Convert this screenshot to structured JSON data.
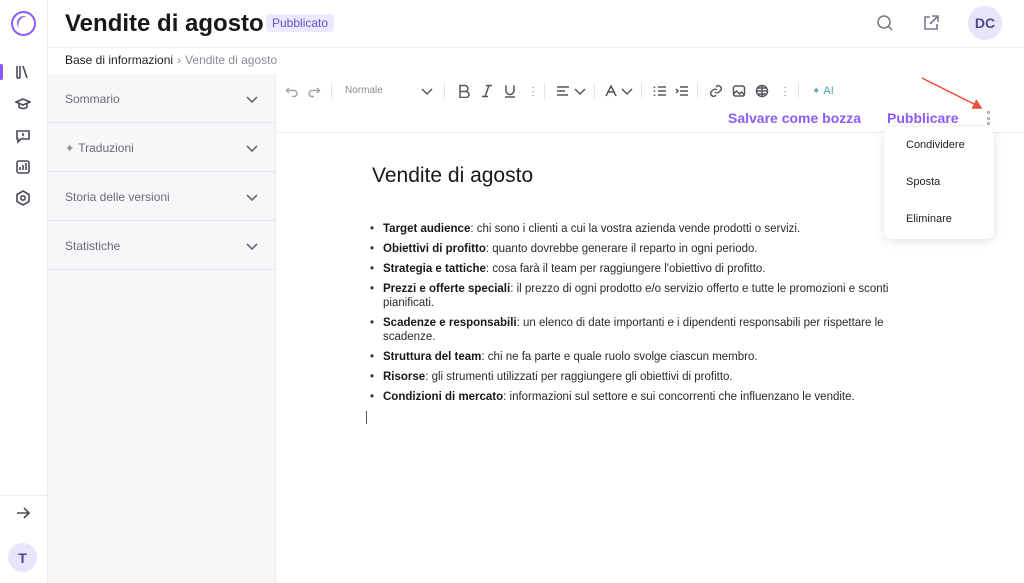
{
  "header": {
    "title": "Vendite di agosto",
    "status_badge": "Pubblicato",
    "avatar_initials": "DC"
  },
  "rail": {
    "icons": [
      "book-icon",
      "graduation-cap-icon",
      "feedback-icon",
      "analytics-icon",
      "settings-icon"
    ],
    "expand_icon": "arrow-right-icon",
    "user_initial": "T"
  },
  "breadcrumb": {
    "root": "Base di informazioni",
    "current": "Vendite di agosto"
  },
  "panel": {
    "sections": [
      {
        "label": "Sommario"
      },
      {
        "label": "Traduzioni"
      },
      {
        "label": "Storia delle versioni"
      },
      {
        "label": "Statistiche"
      }
    ]
  },
  "toolbar": {
    "style": "Normale",
    "ai_label": "AI"
  },
  "actions": {
    "save_draft": "Salvare come bozza",
    "publish": "Pubblicare"
  },
  "menu": {
    "items": [
      "Condividere",
      "Sposta",
      "Eliminare"
    ]
  },
  "document": {
    "title": "Vendite di agosto",
    "items": [
      {
        "term": "Target audience",
        "text": ": chi sono i clienti a cui la vostra azienda vende prodotti o servizi."
      },
      {
        "term": "Obiettivi di profitto",
        "text": ": quanto dovrebbe generare il reparto in ogni periodo."
      },
      {
        "term": "Strategia e tattiche",
        "text": ": cosa farà il team per raggiungere l'obiettivo di profitto."
      },
      {
        "term": "Prezzi e offerte speciali",
        "text": ": il prezzo di ogni prodotto e/o servizio offerto e tutte le promozioni e sconti pianificati."
      },
      {
        "term": "Scadenze e responsabili",
        "text": ": un elenco di date importanti e i dipendenti responsabili per rispettare le scadenze."
      },
      {
        "term": "Struttura del team",
        "text": ": chi ne fa parte e quale ruolo svolge ciascun membro."
      },
      {
        "term": "Risorse",
        "text": ": gli strumenti utilizzati per raggiungere gli obiettivi di profitto."
      },
      {
        "term": "Condizioni di mercato",
        "text": ": informazioni sul settore e sui concorrenti che influenzano le vendite."
      }
    ]
  },
  "colors": {
    "accent": "#8b5cf6",
    "annotation_arrow": "#e8503a"
  }
}
